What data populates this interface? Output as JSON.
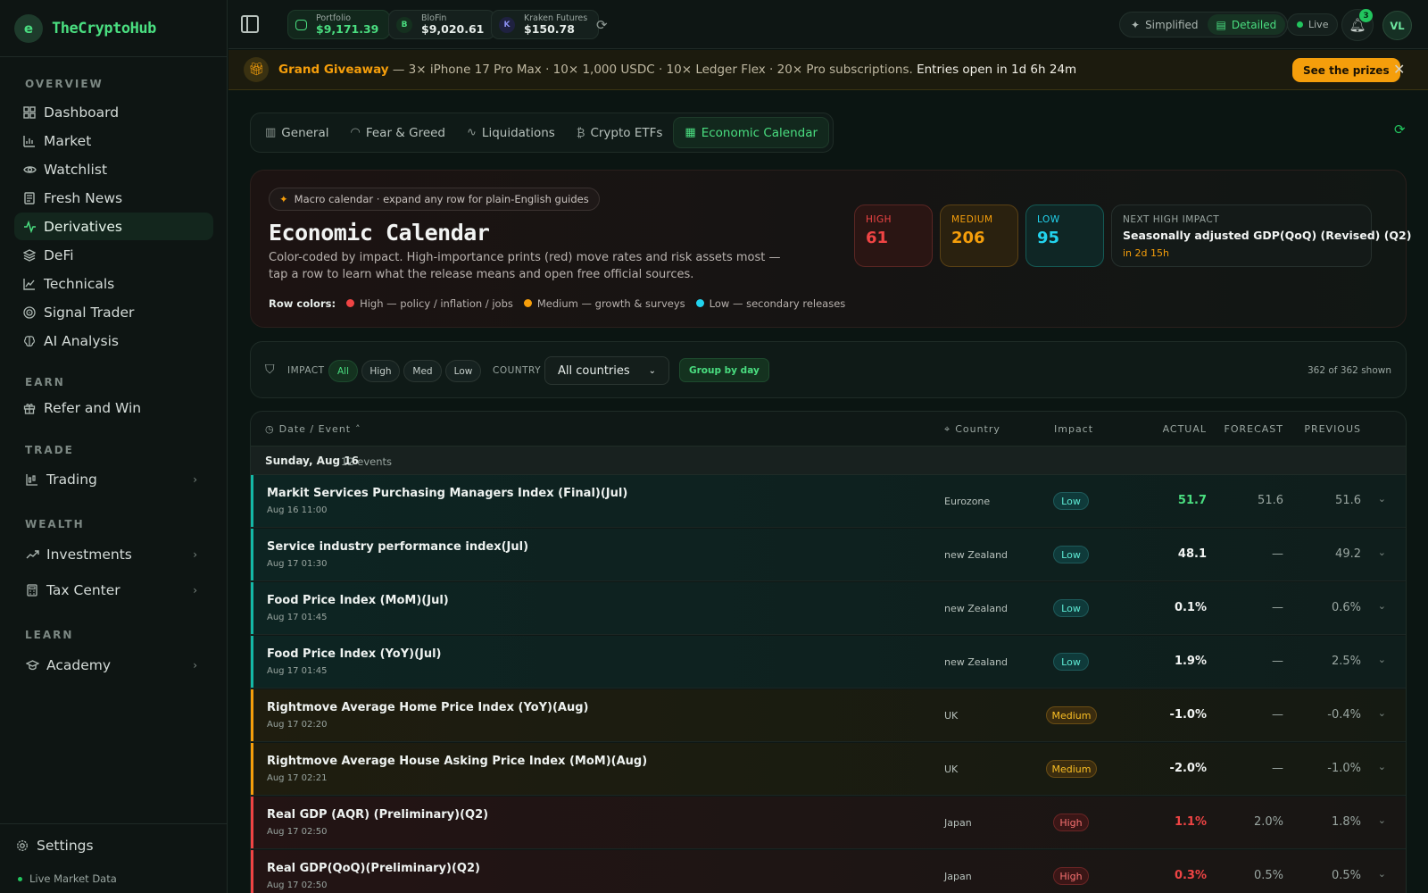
{
  "app": {
    "name": "TheCryptoHub",
    "logo_letter": "e"
  },
  "sidebar": {
    "sections": [
      {
        "title": "OVERVIEW"
      },
      {
        "title": "EARN"
      },
      {
        "title": "TRADE"
      },
      {
        "title": "WEALTH"
      },
      {
        "title": "LEARN"
      }
    ],
    "items": [
      {
        "label": "Dashboard",
        "icon": "dashboard-icon"
      },
      {
        "label": "Market",
        "icon": "market-icon"
      },
      {
        "label": "Watchlist",
        "icon": "eye-icon"
      },
      {
        "label": "Fresh News",
        "icon": "newspaper-icon"
      },
      {
        "label": "Derivatives",
        "icon": "activity-icon",
        "active": true
      },
      {
        "label": "DeFi",
        "icon": "layers-icon"
      },
      {
        "label": "Technicals",
        "icon": "line-chart-icon"
      },
      {
        "label": "Signal Trader",
        "icon": "target-icon"
      },
      {
        "label": "AI Analysis",
        "icon": "brain-icon"
      },
      {
        "label": "Refer and Win",
        "icon": "gift-icon"
      },
      {
        "label": "Trading",
        "icon": "candles-icon"
      },
      {
        "label": "Investments",
        "icon": "trending-up-icon"
      },
      {
        "label": "Tax Center",
        "icon": "calculator-icon"
      },
      {
        "label": "Academy",
        "icon": "graduation-cap-icon"
      }
    ],
    "settings_label": "Settings",
    "live_data_label": "Live Market Data"
  },
  "topbar": {
    "wallets": [
      {
        "label": "Portfolio",
        "value": "$9,171.39"
      },
      {
        "label": "BloFin",
        "value": "$9,020.61",
        "letter": "B"
      },
      {
        "label": "Kraken Futures",
        "value": "$150.78",
        "letter": "K"
      }
    ],
    "view_modes": [
      "Simplified",
      "Detailed"
    ],
    "active_view": "Detailed",
    "live_label": "Live",
    "notification_count": "3",
    "avatar_initials": "VL"
  },
  "banner": {
    "title": "Grand Giveaway",
    "text": " — 3× iPhone 17 Pro Max · 10× 1,000 USDC · 10× Ledger Flex · 20× Pro subscriptions. ",
    "countdown": "Entries open in 1d 6h 24m",
    "cta": "See the prizes"
  },
  "tabs": [
    {
      "label": "General",
      "icon": "bar-chart-icon"
    },
    {
      "label": "Fear & Greed",
      "icon": "gauge-icon"
    },
    {
      "label": "Liquidations",
      "icon": "activity-icon"
    },
    {
      "label": "Crypto ETFs",
      "icon": "bitcoin-icon"
    },
    {
      "label": "Economic Calendar",
      "icon": "calendar-icon",
      "active": true
    }
  ],
  "hero": {
    "pill": "Macro calendar · expand any row for plain-English guides",
    "title": "Economic Calendar",
    "description": "Color-coded by impact. High-importance prints (red) move rates and risk assets most — tap a row to learn what the release means and open free official sources.",
    "row_colors_label": "Row colors:",
    "legend": [
      {
        "label": "High — policy / inflation / jobs",
        "color": "#ef4444"
      },
      {
        "label": "Medium — growth & surveys",
        "color": "#f59e0b"
      },
      {
        "label": "Low — secondary releases",
        "color": "#22d3ee"
      }
    ],
    "stats": {
      "high": {
        "label": "HIGH",
        "value": "61"
      },
      "medium": {
        "label": "MEDIUM",
        "value": "206"
      },
      "low": {
        "label": "LOW",
        "value": "95"
      },
      "next": {
        "label": "NEXT HIGH IMPACT",
        "title": "Seasonally adjusted GDP(QoQ) (Revised) (Q2)",
        "when": "in 2d 15h"
      }
    }
  },
  "filters": {
    "impact_label": "IMPACT",
    "impact_options": [
      "All",
      "High",
      "Med",
      "Low"
    ],
    "impact_selected": "All",
    "country_label": "COUNTRY",
    "country_value": "All countries",
    "group_by_label": "Group by day",
    "shown": "362 of 362 shown"
  },
  "table": {
    "headers": {
      "event": "Date / Event",
      "country": "Country",
      "impact": "Impact",
      "actual": "ACTUAL",
      "forecast": "FORECAST",
      "previous": "PREVIOUS"
    },
    "day": {
      "label": "Sunday, Aug 16",
      "count": "12 events"
    },
    "rows": [
      {
        "name": "Markit Services Purchasing Managers Index (Final)(Jul)",
        "time": "Aug 16 11:00",
        "country": "Eurozone",
        "impact": "Low",
        "actual": "51.7",
        "actual_color": "#4ade80",
        "forecast": "51.6",
        "previous": "51.6"
      },
      {
        "name": "Service industry performance index(Jul)",
        "time": "Aug 17 01:30",
        "country": "new Zealand",
        "impact": "Low",
        "actual": "48.1",
        "actual_color": "#f2f4f3",
        "forecast": "—",
        "previous": "49.2"
      },
      {
        "name": "Food Price Index (MoM)(Jul)",
        "time": "Aug 17 01:45",
        "country": "new Zealand",
        "impact": "Low",
        "actual": "0.1%",
        "actual_color": "#f2f4f3",
        "forecast": "—",
        "previous": "0.6%"
      },
      {
        "name": "Food Price Index (YoY)(Jul)",
        "time": "Aug 17 01:45",
        "country": "new Zealand",
        "impact": "Low",
        "actual": "1.9%",
        "actual_color": "#f2f4f3",
        "forecast": "—",
        "previous": "2.5%"
      },
      {
        "name": "Rightmove Average Home Price Index (YoY)(Aug)",
        "time": "Aug 17 02:20",
        "country": "UK",
        "impact": "Medium",
        "actual": "-1.0%",
        "actual_color": "#f2f4f3",
        "forecast": "—",
        "previous": "-0.4%"
      },
      {
        "name": "Rightmove Average House Asking Price Index (MoM)(Aug)",
        "time": "Aug 17 02:21",
        "country": "UK",
        "impact": "Medium",
        "actual": "-2.0%",
        "actual_color": "#f2f4f3",
        "forecast": "—",
        "previous": "-1.0%"
      },
      {
        "name": "Real GDP (AQR) (Preliminary)(Q2)",
        "time": "Aug 17 02:50",
        "country": "Japan",
        "impact": "High",
        "actual": "1.1%",
        "actual_color": "#ef4444",
        "forecast": "2.0%",
        "previous": "1.8%"
      },
      {
        "name": "Real GDP(QoQ)(Preliminary)(Q2)",
        "time": "Aug 17 02:50",
        "country": "Japan",
        "impact": "High",
        "actual": "0.3%",
        "actual_color": "#ef4444",
        "forecast": "0.5%",
        "previous": "0.5%"
      }
    ]
  }
}
